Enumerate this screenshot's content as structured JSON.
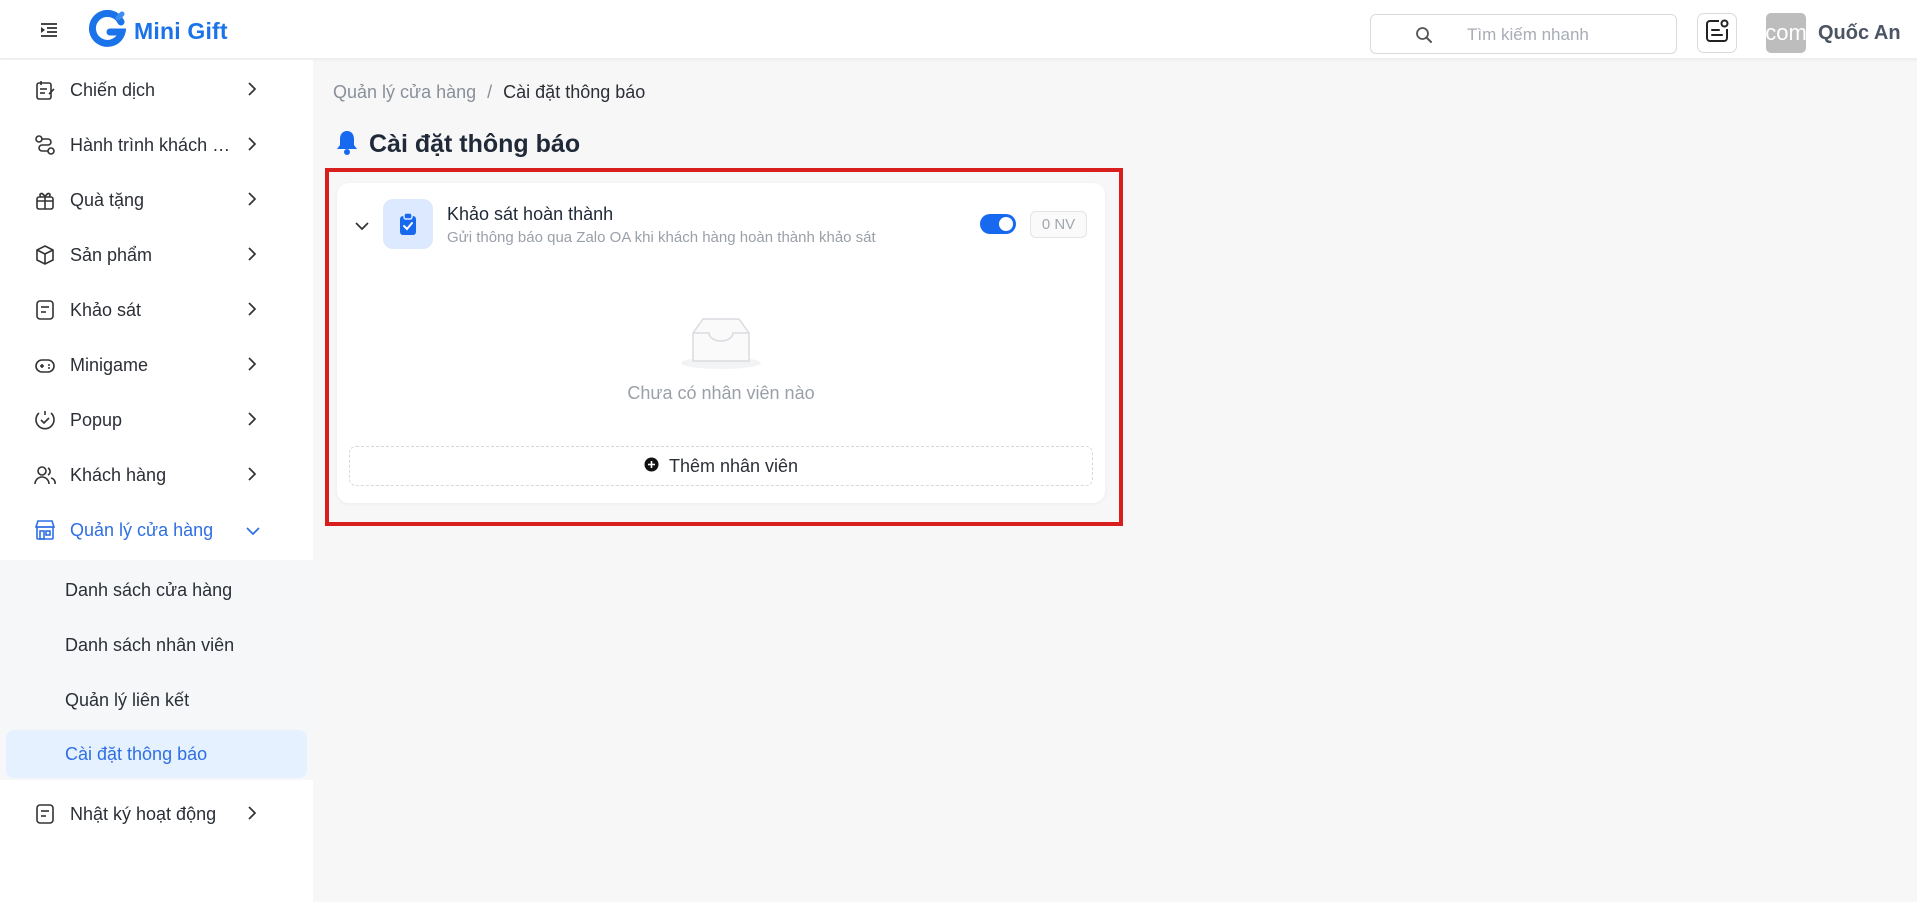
{
  "app": {
    "name": "Mini Gift"
  },
  "header": {
    "search_placeholder": "Tìm kiếm nhanh",
    "user_name": "Quốc An",
    "avatar_text": "com"
  },
  "sidebar": {
    "items": [
      {
        "label": "Chiến dịch",
        "icon": "campaign-icon"
      },
      {
        "label": "Hành trình khách hàng",
        "icon": "journey-icon"
      },
      {
        "label": "Quà tặng",
        "icon": "gift-icon"
      },
      {
        "label": "Sản phẩm",
        "icon": "product-box-icon"
      },
      {
        "label": "Khảo sát",
        "icon": "survey-icon"
      },
      {
        "label": "Minigame",
        "icon": "gamepad-icon"
      },
      {
        "label": "Popup",
        "icon": "popup-icon"
      },
      {
        "label": "Khách hàng",
        "icon": "customers-icon"
      },
      {
        "label": "Quản lý cửa hàng",
        "icon": "store-icon",
        "expanded": true
      },
      {
        "label": "Nhật ký hoạt động",
        "icon": "activity-log-icon"
      }
    ],
    "submenu": [
      {
        "label": "Danh sách cửa hàng"
      },
      {
        "label": "Danh sách nhân viên"
      },
      {
        "label": "Quản lý liên kết"
      },
      {
        "label": "Cài đặt thông báo",
        "selected": true
      }
    ]
  },
  "breadcrumb": {
    "parent": "Quản lý cửa hàng",
    "separator": "/",
    "current": "Cài đặt thông báo"
  },
  "page": {
    "title": "Cài đặt thông báo"
  },
  "notification_card": {
    "title": "Khảo sát hoàn thành",
    "description": "Gửi thông báo qua Zalo OA khi khách hàng hoàn thành khảo sát",
    "enabled": true,
    "count_badge": "0 NV",
    "empty_text": "Chưa có nhân viên nào",
    "add_button_label": "Thêm nhân viên"
  },
  "colors": {
    "accent": "#1769f0",
    "brand": "#1a73e8",
    "highlight_border": "#d91e1e",
    "selected_bg": "#e6f1ff"
  }
}
